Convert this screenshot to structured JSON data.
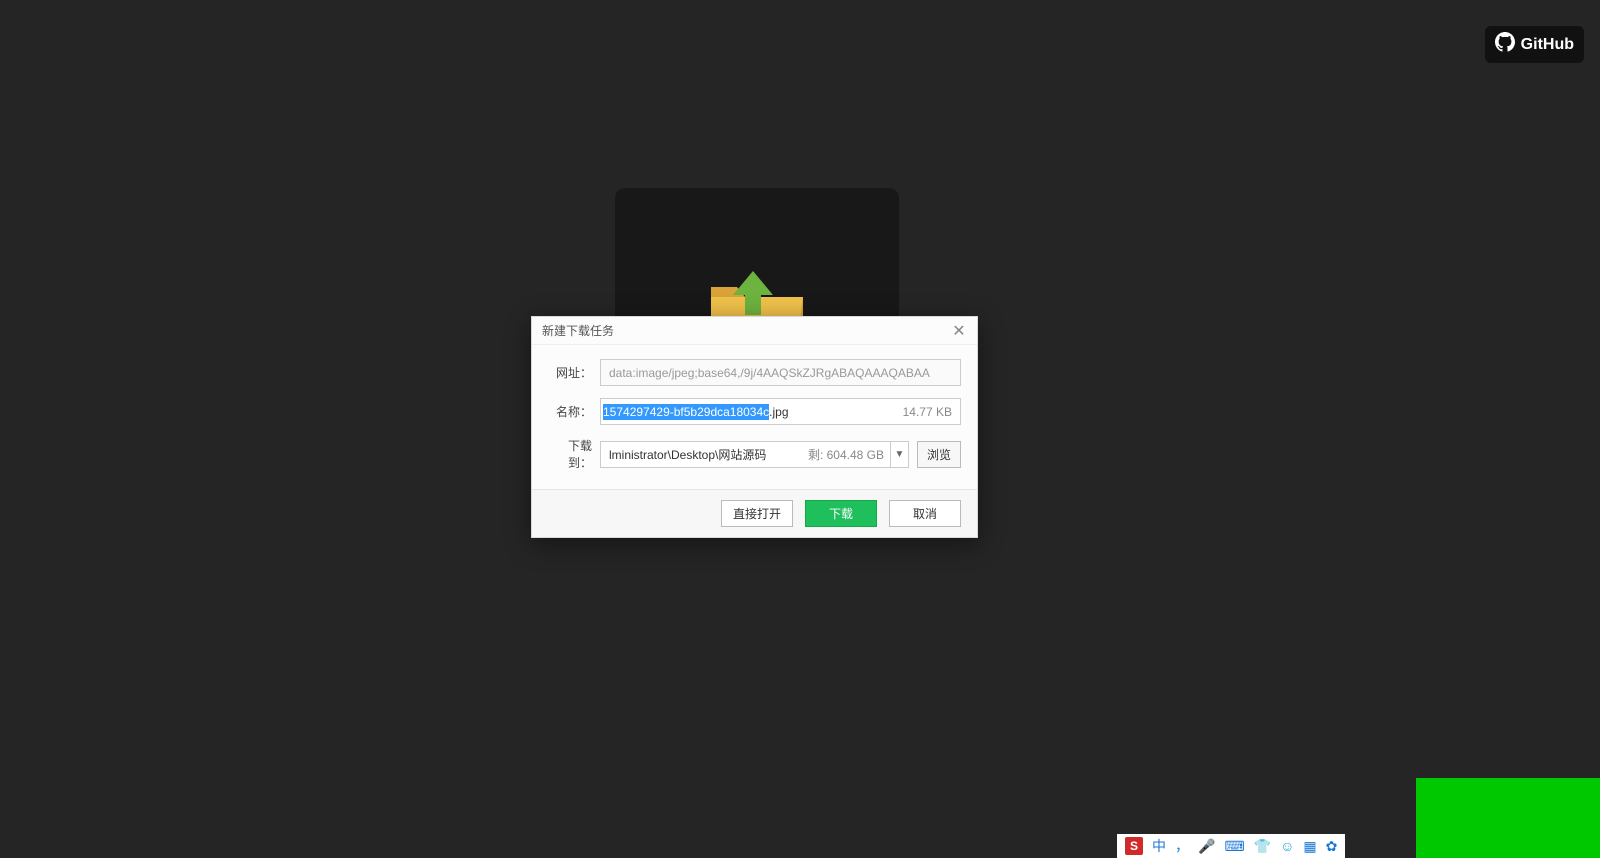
{
  "header": {
    "github_label": "GitHub"
  },
  "dialog": {
    "title": "新建下载任务",
    "labels": {
      "url": "网址：",
      "name": "名称：",
      "path": "下载到："
    },
    "url_value": "data:image/jpeg;base64,/9j/4AAQSkZJRgABAQAAAQABAA",
    "name_selected": "1574297429-bf5b29dca18034c",
    "name_ext": ".jpg",
    "file_size": "14.77 KB",
    "path_value": "lministrator\\Desktop\\网站源码",
    "free_space": "剩: 604.48 GB",
    "browse": "浏览",
    "buttons": {
      "open": "直接打开",
      "download": "下载",
      "cancel": "取消"
    }
  },
  "ime": {
    "s": "S",
    "cn": "中",
    "dot": "，",
    "mic": "🎤",
    "kbd": "⌨",
    "shirt": "👕",
    "face": "☺",
    "grid": "▦",
    "gear": "✿"
  }
}
